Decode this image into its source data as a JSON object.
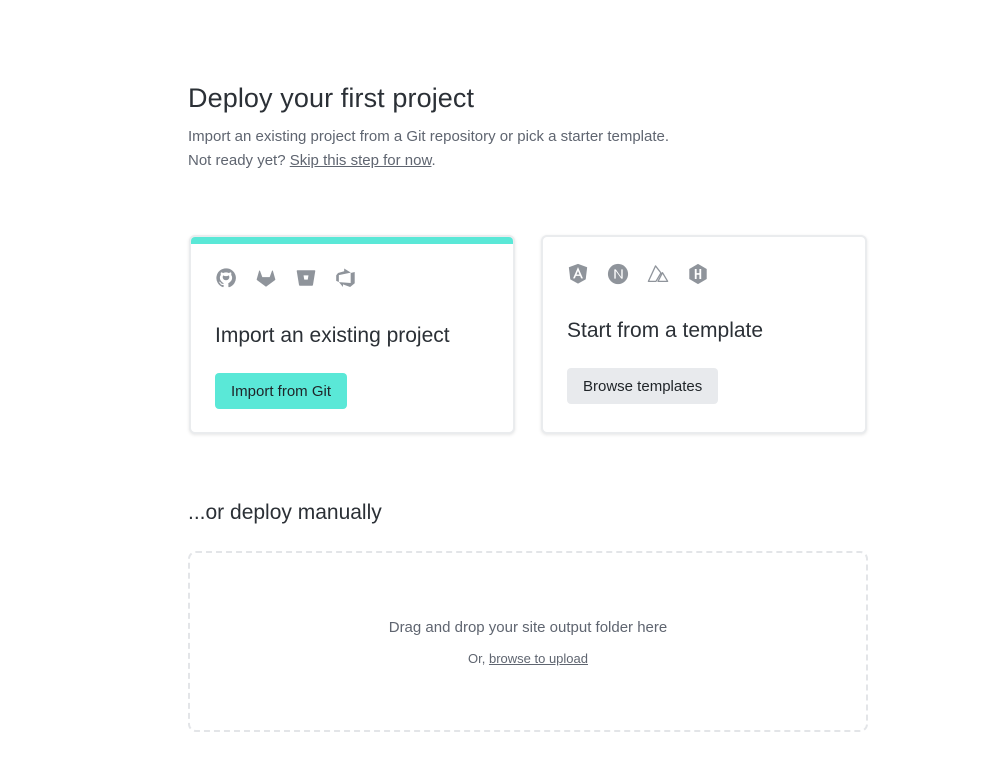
{
  "header": {
    "title": "Deploy your first project",
    "subtitle": "Import an existing project from a Git repository or pick a starter template.",
    "not_ready_prefix": "Not ready yet? ",
    "skip_link": "Skip this step for now",
    "not_ready_suffix": "."
  },
  "import_card": {
    "icons": [
      "github-icon",
      "gitlab-icon",
      "bitbucket-icon",
      "azure-devops-icon"
    ],
    "title": "Import an existing project",
    "button_label": "Import from Git",
    "accent_color": "#5ae8d7"
  },
  "template_card": {
    "icons": [
      "angular-icon",
      "nextjs-icon",
      "nuxt-icon",
      "hugo-icon"
    ],
    "title": "Start from a template",
    "button_label": "Browse templates"
  },
  "manual": {
    "title": "...or deploy manually",
    "drop_text": "Drag and drop your site output folder here",
    "or_prefix": "Or, ",
    "browse_link": "browse to upload"
  },
  "colors": {
    "accent": "#5ae8d7",
    "icon_gray": "#8f949b",
    "secondary_button": "#e8eaed"
  }
}
